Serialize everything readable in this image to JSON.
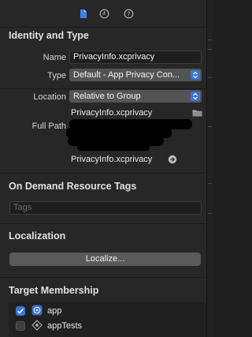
{
  "toolbar": {
    "icons": [
      "file-icon",
      "history-icon",
      "help-icon"
    ]
  },
  "identity": {
    "title": "Identity and Type",
    "name_label": "Name",
    "name_value": "PrivacyInfo.xcprivacy",
    "type_label": "Type",
    "type_value": "Default - App Privacy Con...",
    "location_label": "Location",
    "location_value": "Relative to Group",
    "location_file": "PrivacyInfo.xcprivacy",
    "fullpath_label": "Full Path",
    "fullpath_file": "PrivacyInfo.xcprivacy"
  },
  "tags": {
    "title": "On Demand Resource Tags",
    "placeholder": "Tags"
  },
  "localization": {
    "title": "Localization",
    "button_label": "Localize..."
  },
  "membership": {
    "title": "Target Membership",
    "targets": [
      {
        "name": "app",
        "checked": true
      },
      {
        "name": "appTests",
        "checked": false
      }
    ]
  },
  "colors": {
    "accent": "#3b74d8",
    "background": "#272727"
  }
}
